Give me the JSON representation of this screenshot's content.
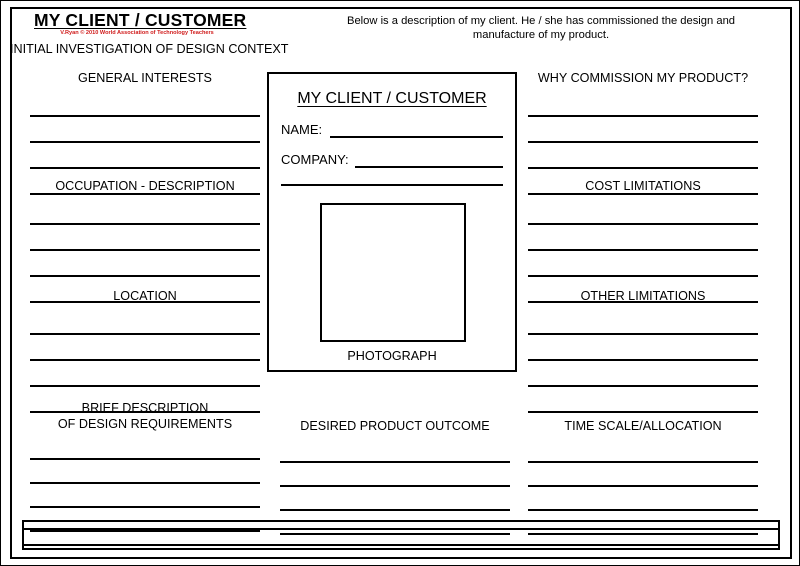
{
  "header": {
    "title": "MY CLIENT / CUSTOMER",
    "credit": "V.Ryan © 2010 World Association of Technology Teachers",
    "subtitle": "INITIAL INVESTIGATION OF DESIGN CONTEXT",
    "intro": "Below is a description of my client. He / she has commissioned the design and manufacture of my product."
  },
  "card": {
    "title": "MY CLIENT / CUSTOMER",
    "name_label": "NAME:",
    "company_label": "COMPANY:",
    "photo_caption": "PHOTOGRAPH"
  },
  "left_column": [
    {
      "title": "GENERAL INTERESTS",
      "lines": 4
    },
    {
      "title": "OCCUPATION - DESCRIPTION",
      "lines": 4
    },
    {
      "title": "LOCATION",
      "lines": 4
    }
  ],
  "right_column": [
    {
      "title": "WHY COMMISSION MY PRODUCT?",
      "lines": 4
    },
    {
      "title": "COST LIMITATIONS",
      "lines": 4
    },
    {
      "title": "OTHER LIMITATIONS",
      "lines": 4
    }
  ],
  "bottom_row": [
    {
      "title": "BRIEF DESCRIPTION\nOF DESIGN REQUIREMENTS",
      "lines": 4
    },
    {
      "title": "DESIRED PRODUCT OUTCOME",
      "lines": 4
    },
    {
      "title": "TIME SCALE/ALLOCATION",
      "lines": 4
    }
  ],
  "colors": {
    "ink": "#000000",
    "credit": "#d01b1b",
    "paper": "#ffffff"
  }
}
